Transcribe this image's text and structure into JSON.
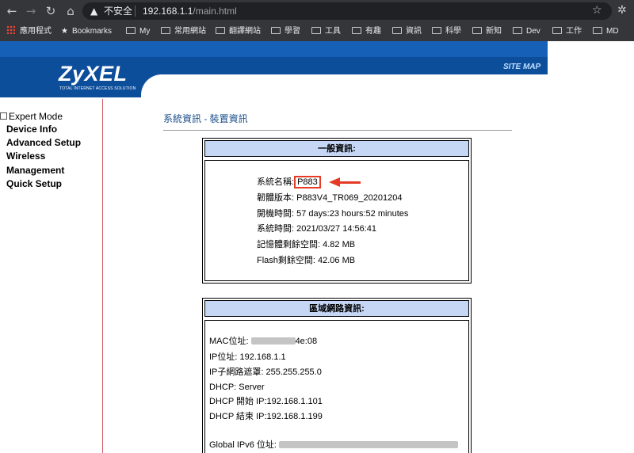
{
  "browser": {
    "back": "←",
    "forward": "→",
    "reload": "↻",
    "home": "⌂",
    "warning": "▲",
    "insecure_label": "不安全",
    "url_host": "192.168.1.1",
    "url_path": "/main.html",
    "star": "☆",
    "extension": "✲"
  },
  "bookmarks": {
    "apps": "應用程式",
    "bookmarks": "Bookmarks",
    "items": [
      "My",
      "常用網站",
      "翻譯網站",
      "學習",
      "工具",
      "有趣",
      "資訊",
      "科學",
      "新知",
      "Dev",
      "工作",
      "MD"
    ]
  },
  "header": {
    "logo": "ZyXEL",
    "logo_sub": "TOTAL INTERNET ACCESS SOLUTION",
    "sitemap": "SITE MAP"
  },
  "sidebar": {
    "expert_mode": "Expert Mode",
    "items": [
      "Device Info",
      "Advanced Setup",
      "Wireless",
      "Management",
      "Quick Setup"
    ]
  },
  "main": {
    "title": "系統資訊 - 裝置資訊",
    "general": {
      "heading": "一般資訊:",
      "system_name_label": "系統名稱:",
      "system_name": "P883",
      "firmware": "韌體版本: P883V4_TR069_20201204",
      "uptime": "開機時間: 57 days:23 hours:52 minutes",
      "system_time": "系統時間: 2021/03/27 14:56:41",
      "memory": "記憶體剩餘空間: 4.82 MB",
      "flash": "Flash剩餘空間: 42.06 MB"
    },
    "lan": {
      "heading": "區域網路資訊:",
      "mac_label": "MAC位址:",
      "mac_tail": "4e:08",
      "ip": "IP位址: 192.168.1.1",
      "subnet": "IP子網路遮罩: 255.255.255.0",
      "dhcp": "DHCP: Server",
      "dhcp_start": "DHCP 開始 IP:192.168.1.101",
      "dhcp_end": "DHCP 結束 IP:192.168.1.199",
      "ipv6_label": "Global IPv6 位址:"
    }
  }
}
